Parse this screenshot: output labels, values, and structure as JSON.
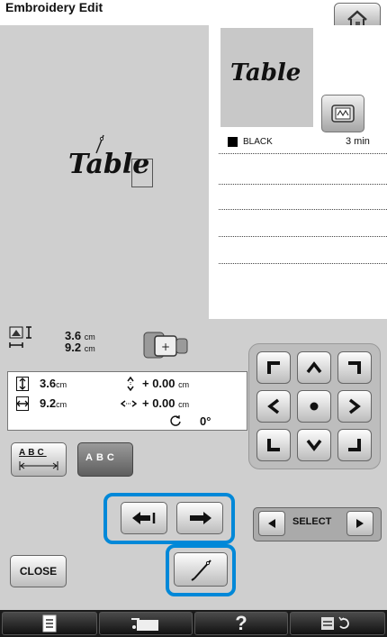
{
  "header": {
    "title": "Embroidery Edit"
  },
  "preview": {
    "text": "Table"
  },
  "edit_area": {
    "text": "Table"
  },
  "thread_list": {
    "items": [
      {
        "color": "#000000",
        "name": "BLACK",
        "time": "3 min"
      }
    ]
  },
  "pattern_size": {
    "height": "3.6",
    "width": "9.2",
    "unit": "cm"
  },
  "info": {
    "height": "3.6",
    "width": "9.2",
    "unit": "cm",
    "offset_y": "+ 0.00",
    "offset_x": "+ 0.00",
    "rotation": "0°"
  },
  "array_buttons": {
    "abc_label": "ABC",
    "abc_active_label": "ABC"
  },
  "select": {
    "label": "SELECT"
  },
  "buttons": {
    "close": "CLOSE"
  },
  "colors": {
    "highlight": "#0088d8",
    "panel": "#cfcfcf",
    "bar": "#1a1a1a"
  },
  "icons": [
    "home-icon",
    "frame-icon",
    "arrow-left-icon",
    "arrow-right-icon",
    "needle-icon",
    "page-icon",
    "sewing-icon",
    "help-icon",
    "settings-icon"
  ]
}
